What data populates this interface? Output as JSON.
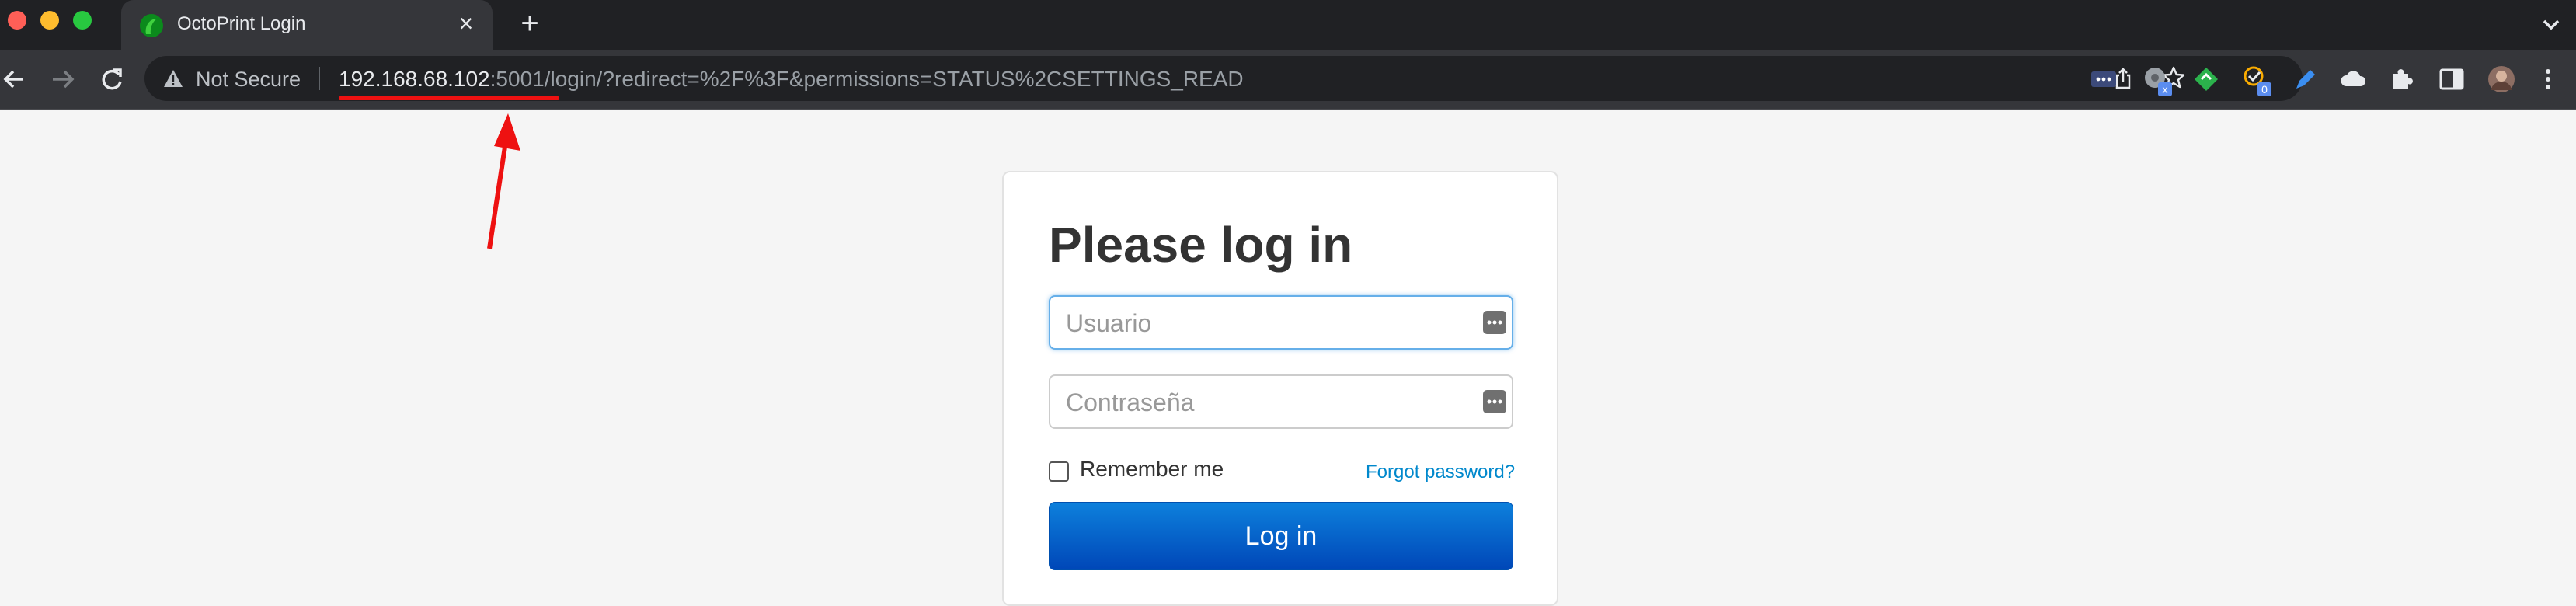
{
  "browser": {
    "tab": {
      "title": "OctoPrint Login"
    },
    "omnibox": {
      "security_label": "Not Secure",
      "url_host": "192.168.68.102",
      "url_rest": ":5001/login/?redirect=%2F%3F&permissions=STATUS%2CSETTINGS_READ"
    },
    "extensions": [
      {
        "name": "dots-extension-icon"
      },
      {
        "name": "chrome-ext-icon",
        "badge": "x"
      },
      {
        "name": "feedly-icon"
      },
      {
        "name": "todo-check-icon",
        "badge": "0"
      },
      {
        "name": "pen-icon"
      },
      {
        "name": "cloud-icon"
      },
      {
        "name": "puzzle-icon"
      },
      {
        "name": "sidepanel-icon"
      },
      {
        "name": "profile-avatar"
      },
      {
        "name": "kebab-menu-icon"
      }
    ]
  },
  "login": {
    "title": "Please log in",
    "username_placeholder": "Usuario",
    "password_placeholder": "Contraseña",
    "remember_label": "Remember me",
    "forgot_link": "Forgot password?",
    "submit_label": "Log in"
  },
  "colors": {
    "primary_button": "#0d6fd1",
    "link": "#0088cc",
    "annotation": "#ee1111"
  }
}
